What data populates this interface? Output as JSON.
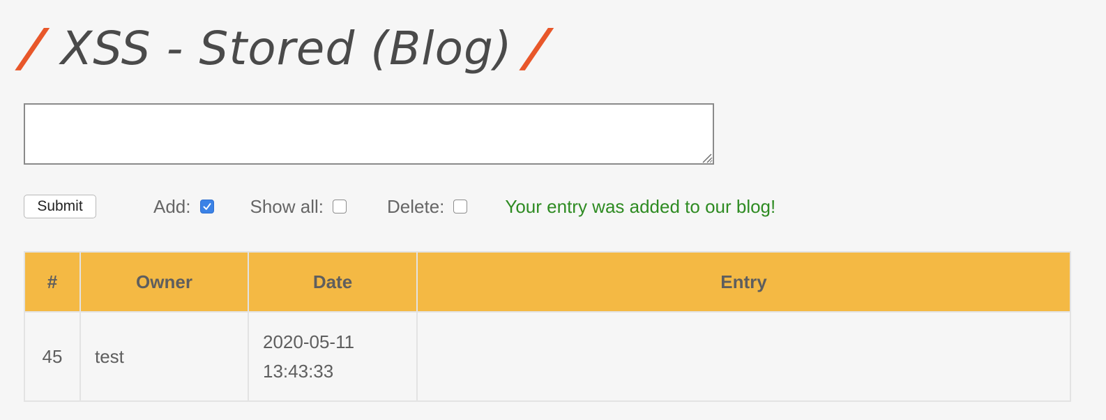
{
  "page": {
    "title": "XSS - Stored (Blog)",
    "title_slash_left": "/",
    "title_slash_right": "/"
  },
  "entry_form": {
    "textarea_value": "",
    "submit_label": "Submit",
    "add_label": "Add:",
    "add_checked": true,
    "show_all_label": "Show all:",
    "show_all_checked": false,
    "delete_label": "Delete:",
    "delete_checked": false,
    "status_message": "Your entry was added to our blog!"
  },
  "table": {
    "headers": [
      "#",
      "Owner",
      "Date",
      "Entry"
    ],
    "rows": [
      {
        "num": "45",
        "owner": "test",
        "date_line1": "2020-05-11",
        "date_line2": "13:43:33",
        "entry": ""
      }
    ]
  },
  "colors": {
    "accent_slash": "#e8572a",
    "header_bg": "#f4b944",
    "success_text": "#2e8b22",
    "checkbox_checked": "#3b82e6"
  }
}
